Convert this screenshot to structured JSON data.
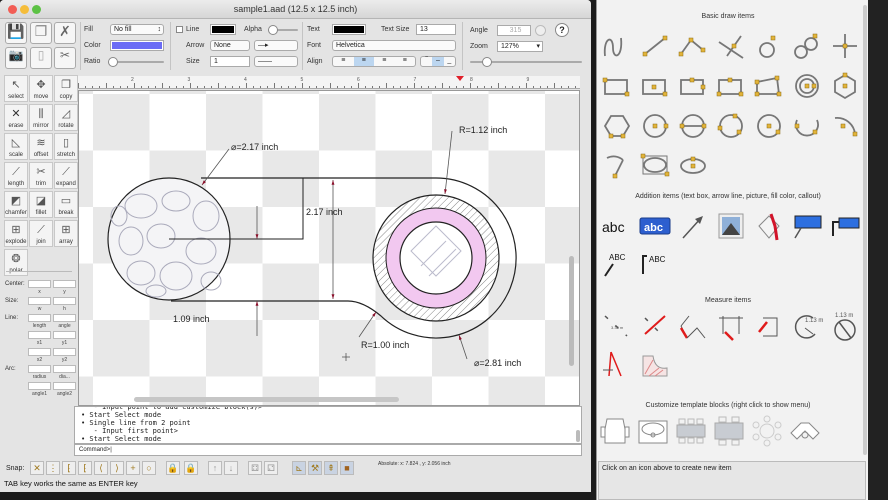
{
  "window": {
    "title": "sample1.aad (12.5 x 12.5 inch)"
  },
  "toolbar": {
    "fill_label": "Fill",
    "fill_value": "No fill",
    "color_label": "Color",
    "color_value": "#6b6cf5",
    "ratio_label": "Ratio",
    "line_label": "Line",
    "line_color": "#000000",
    "alpha_label": "Alpha",
    "arrow_label": "Arrow",
    "arrow_value": "None",
    "size_label": "Size",
    "size_value": "1",
    "text_label": "Text",
    "text_color": "#000000",
    "text_size_label": "Text Size",
    "text_size_value": "13",
    "font_label": "Font",
    "font_value": "Helvetica",
    "align_label": "Align",
    "angle_label": "Angle",
    "angle_value": "315",
    "zoom_label": "Zoom",
    "zoom_value": "127%",
    "help": "?"
  },
  "tools": [
    {
      "label": "select",
      "icon": "cursor-icon",
      "g": "↖"
    },
    {
      "label": "move",
      "icon": "move-icon",
      "g": "✥"
    },
    {
      "label": "copy",
      "icon": "copy-icon",
      "g": "❐"
    },
    {
      "label": "erase",
      "icon": "erase-icon",
      "g": "✕"
    },
    {
      "label": "mirror",
      "icon": "mirror-icon",
      "g": "⫼"
    },
    {
      "label": "rotate",
      "icon": "rotate-icon",
      "g": "◿"
    },
    {
      "label": "scale",
      "icon": "scale-icon",
      "g": "◺"
    },
    {
      "label": "offset",
      "icon": "offset-icon",
      "g": "≋"
    },
    {
      "label": "stretch",
      "icon": "stretch-icon",
      "g": "▯"
    },
    {
      "label": "length",
      "icon": "length-icon",
      "g": "⟋"
    },
    {
      "label": "trim",
      "icon": "trim-icon",
      "g": "✂"
    },
    {
      "label": "expand",
      "icon": "expand-icon",
      "g": "⟋"
    },
    {
      "label": "chamfer",
      "icon": "chamfer-icon",
      "g": "◩"
    },
    {
      "label": "fillet",
      "icon": "fillet-icon",
      "g": "◪"
    },
    {
      "label": "break",
      "icon": "break-icon",
      "g": "▭"
    },
    {
      "label": "explode",
      "icon": "explode-icon",
      "g": "⊞"
    },
    {
      "label": "join",
      "icon": "join-icon",
      "g": "⟋"
    },
    {
      "label": "array",
      "icon": "array-icon",
      "g": "⊞"
    },
    {
      "label": "polar",
      "icon": "polar-icon",
      "g": "❂"
    }
  ],
  "props": {
    "center": "Center:",
    "x": "x",
    "y": "y",
    "size": "Size:",
    "w": "w",
    "h": "h",
    "line": "Line:",
    "length": "length",
    "angle": "angle",
    "x1": "x1",
    "y1": "y1",
    "x2": "x2",
    "y2": "y2",
    "arc": "Arc:",
    "radius": "radius",
    "dia": "dia...",
    "angle1": "angle1",
    "angle2": "angle2"
  },
  "drawing": {
    "dim1": "⌀=2.17 inch",
    "dim2": "R=1.12 inch",
    "dim3": "2.17 inch",
    "dim4": "1.09 inch",
    "dim5": "R=1.00 inch",
    "dim6": "⌀=2.81 inch"
  },
  "ruler": {
    "ticks": [
      "2",
      "3",
      "4",
      "5",
      "6",
      "7",
      "8",
      "9"
    ]
  },
  "log": {
    "lines": [
      "   - Input point to add customize block(s)>",
      "• Start Select mode",
      "• Single line from 2 point",
      "   - Input first point>",
      "• Start Select mode"
    ]
  },
  "command": {
    "prompt": "Command>"
  },
  "snap": {
    "label": "Snap:",
    "coords": "Absolute: x: 7.824 , y: 2.056 inch"
  },
  "status": "TAB key works the same as ENTER key",
  "panel": {
    "basic_title": "Basic draw items",
    "addition_title": "Addition items (text box, arrow line, picture, fill color, callout)",
    "measure_title": "Measure items",
    "template_title": "Customize template blocks (right click to show menu)",
    "abc": "abc",
    "abc_box": "abc",
    "abc_up": "ABC",
    "abc_leader": "ABC",
    "m1": "1.13 m",
    "m2": "1.13 m",
    "info": "Click on an icon above to create new item"
  }
}
